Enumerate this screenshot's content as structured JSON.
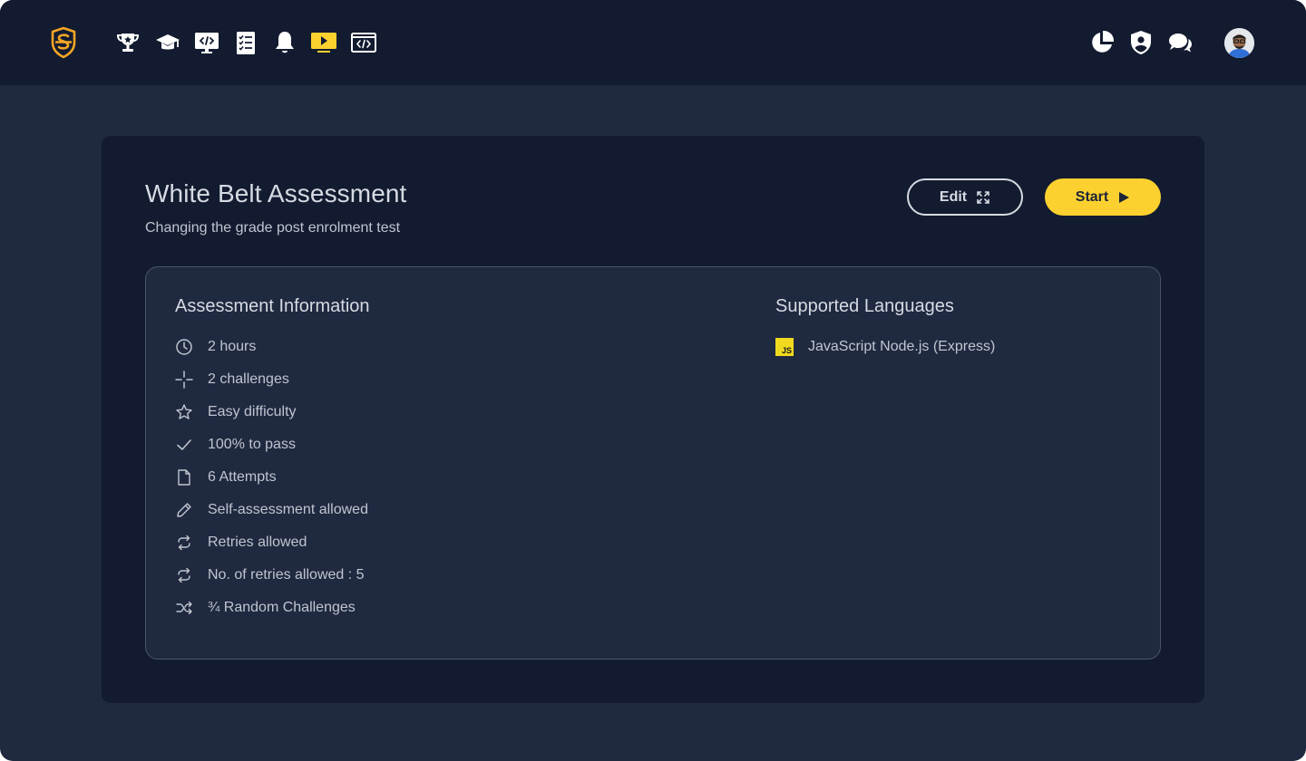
{
  "colors": {
    "accent": "#fcd12f",
    "brand_logo": "#f5a623",
    "topbar_bg": "#131b30",
    "page_bg": "#1f2940",
    "card_bg": "#131b30",
    "text_primary": "#d6dae2",
    "text_secondary": "#c0c5cf"
  },
  "topbar": {
    "logo_icon": "shield-s-logo",
    "nav_icons": [
      "trophy-icon",
      "graduation-cap-icon",
      "code-monitor-icon",
      "checklist-icon",
      "bell-icon",
      "video-play-icon",
      "code-window-icon"
    ],
    "right_icons": [
      "pie-chart-icon",
      "user-shield-icon",
      "chat-bubbles-icon"
    ],
    "avatar": "user-avatar"
  },
  "assessment": {
    "title": "White Belt Assessment",
    "subtitle": "Changing the grade post enrolment test",
    "edit_label": "Edit",
    "start_label": "Start",
    "info_title": "Assessment Information",
    "info_items": [
      {
        "icon": "clock-icon",
        "text": "2 hours"
      },
      {
        "icon": "sparkle-icon",
        "text": "2 challenges"
      },
      {
        "icon": "star-icon",
        "text": "Easy difficulty"
      },
      {
        "icon": "check-icon",
        "text": "100% to pass"
      },
      {
        "icon": "document-icon",
        "text": "6 Attempts"
      },
      {
        "icon": "pencil-icon",
        "text": "Self-assessment allowed"
      },
      {
        "icon": "retry-icon",
        "text": "Retries allowed"
      },
      {
        "icon": "retry-icon",
        "text": "No. of retries allowed : 5"
      },
      {
        "icon": "shuffle-icon",
        "text": "¾ Random Challenges"
      }
    ],
    "languages_title": "Supported Languages",
    "languages": [
      {
        "icon": "javascript-icon",
        "badge": "JS",
        "text": "JavaScript Node.js (Express)"
      }
    ]
  }
}
